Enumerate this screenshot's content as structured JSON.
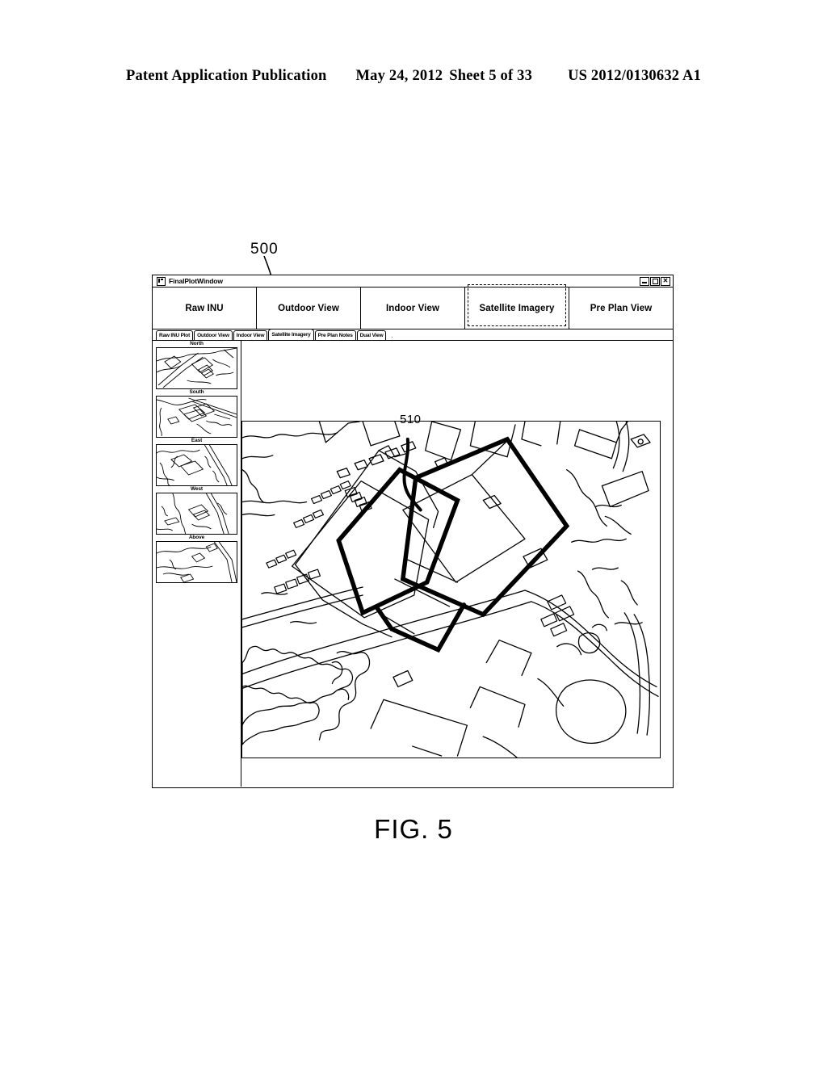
{
  "patent_header": {
    "publication": "Patent Application Publication",
    "date": "May 24, 2012",
    "sheet": "Sheet 5 of 33",
    "number": "US 2012/0130632 A1"
  },
  "figure": {
    "caption": "FIG. 5",
    "callout_window": "500",
    "callout_building": "510"
  },
  "window": {
    "title": "FinalPlotWindow",
    "icon": "window-grid-icon",
    "controls": [
      {
        "name": "minimize",
        "glyph": "–"
      },
      {
        "name": "maximize",
        "glyph": "□"
      },
      {
        "name": "close",
        "glyph": "✕"
      }
    ]
  },
  "main_tabs": [
    {
      "label": "Raw INU",
      "selected": false
    },
    {
      "label": "Outdoor View",
      "selected": false
    },
    {
      "label": "Indoor View",
      "selected": false
    },
    {
      "label": "Satellite Imagery",
      "selected": true
    },
    {
      "label": "Pre Plan View",
      "selected": false
    }
  ],
  "sub_tabs": [
    {
      "label": "Raw INU Plot",
      "active": false
    },
    {
      "label": "Outdoor View",
      "active": false
    },
    {
      "label": "Indoor View",
      "active": false
    },
    {
      "label": "Satellite Imagery",
      "active": true
    },
    {
      "label": "Pre Plan Notes",
      "active": false
    },
    {
      "label": "Dual View",
      "active": false
    }
  ],
  "sub_tabs_trailing": ".",
  "thumbnails": [
    {
      "caption": "North"
    },
    {
      "caption": "South"
    },
    {
      "caption": "East"
    },
    {
      "caption": "West"
    },
    {
      "caption": "Above"
    }
  ],
  "map": {
    "name": "satellite-imagery-map",
    "description": "Line-art satellite plan view of a building complex with roads, parking rows, vegetation and a bold-outlined highlighted structure"
  },
  "colors": {
    "ink": "#000000",
    "paper": "#ffffff"
  }
}
